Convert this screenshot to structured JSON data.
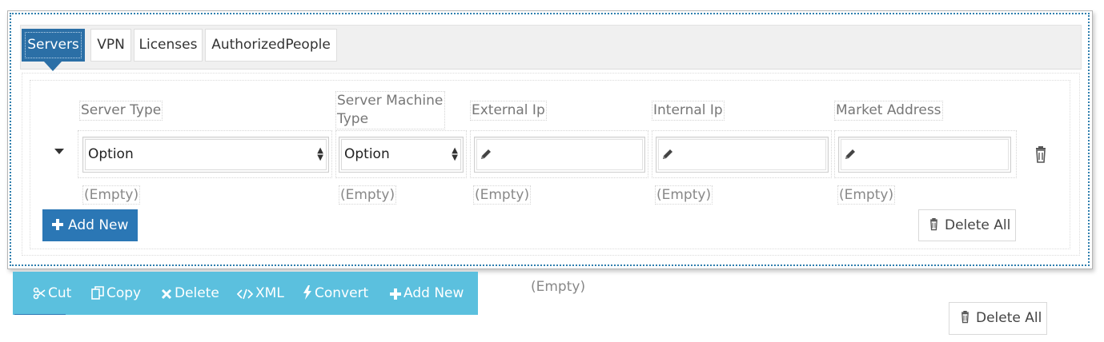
{
  "tabs": [
    {
      "label": "Servers",
      "active": true
    },
    {
      "label": "VPN"
    },
    {
      "label": "Licenses"
    },
    {
      "label": "AuthorizedPeople"
    }
  ],
  "columns": {
    "server_type": "Server Type",
    "server_machine_type": "Server Machine Type",
    "external_ip": "External Ip",
    "internal_ip": "Internal Ip",
    "market_address": "Market Address"
  },
  "row": {
    "server_type_value": "Option",
    "server_machine_type_value": "Option"
  },
  "empty_text": "(Empty)",
  "buttons": {
    "add_new": "Add New",
    "delete_all": "Delete All"
  },
  "toolbar": {
    "cut": "Cut",
    "copy": "Copy",
    "delete": "Delete",
    "xml": "XML",
    "convert": "Convert",
    "add_new": "Add New"
  },
  "colors": {
    "primary": "#2b77b5",
    "tab_active": "#2b6fa6",
    "toolbar": "#5bc0de",
    "selection_dots": "#2f7fae"
  },
  "icons": [
    "caret-down-icon",
    "pencil-icon",
    "trash-icon",
    "plus-icon",
    "scissors-icon",
    "copy-icon",
    "times-icon",
    "code-icon",
    "bolt-icon"
  ]
}
